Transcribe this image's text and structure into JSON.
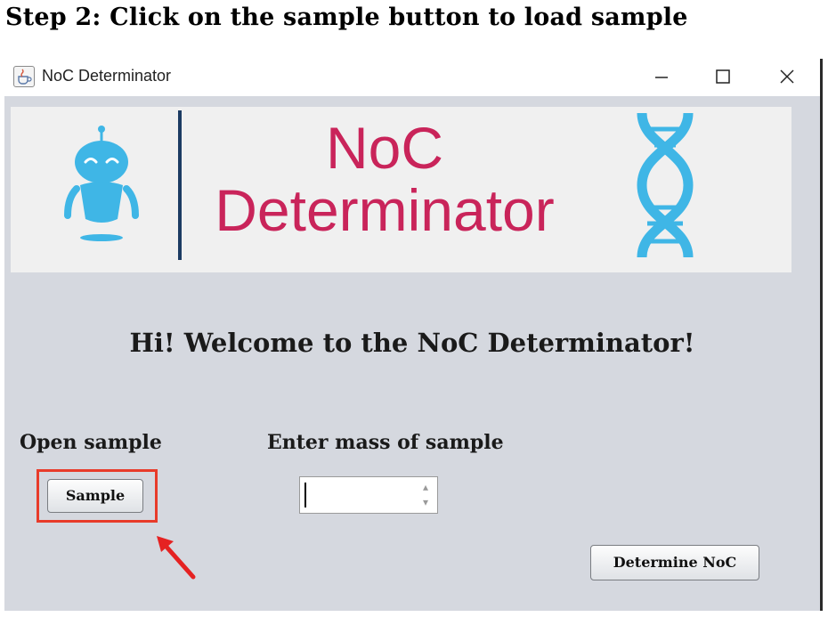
{
  "step_heading": "Step 2: Click on the sample button to load sample",
  "window": {
    "title": "NoC Determinator",
    "app_icon": "java-cup-icon",
    "controls": [
      "minimize-icon",
      "maximize-icon",
      "close-icon"
    ]
  },
  "banner": {
    "title_line1": "NoC",
    "title_line2": "Determinator",
    "brand_color": "#c9245a",
    "accent_color": "#3fb6e6",
    "icons": [
      "robot-icon",
      "dna-icon"
    ]
  },
  "welcome_text": "Hi! Welcome to the NoC Determinator!",
  "open_sample": {
    "label": "Open sample",
    "button_label": "Sample",
    "highlight_color": "#e83b2a"
  },
  "mass": {
    "label": "Enter mass of sample",
    "value": ""
  },
  "determine_button_label": "Determine NoC"
}
